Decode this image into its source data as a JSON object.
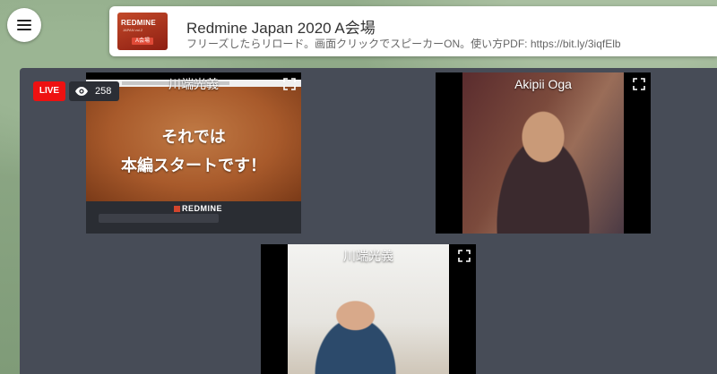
{
  "header": {
    "title": "Redmine Japan 2020 A会場",
    "subtitle": "フリーズしたらリロード。画面クリックでスピーカーON。使い方PDF: https://bit.ly/3iqfElb"
  },
  "logo": {
    "text": "REDMINE",
    "sub": "JAPAN vol.2",
    "badge": "A会場"
  },
  "stream": {
    "live_label": "LIVE",
    "viewer_count": "258"
  },
  "tiles": [
    {
      "label": "川端光義",
      "slide_line1": "それでは",
      "slide_line2": "本編スタートです！",
      "slide_logo": "REDMINE"
    },
    {
      "label": "Akipii Oga"
    },
    {
      "label": "川端光義"
    }
  ],
  "icons": {
    "menu": "hamburger-menu-icon",
    "fullscreen": "fullscreen-icon",
    "viewers": "eye-icon"
  },
  "colors": {
    "live": "#ee1111",
    "stage": "#474c57"
  }
}
